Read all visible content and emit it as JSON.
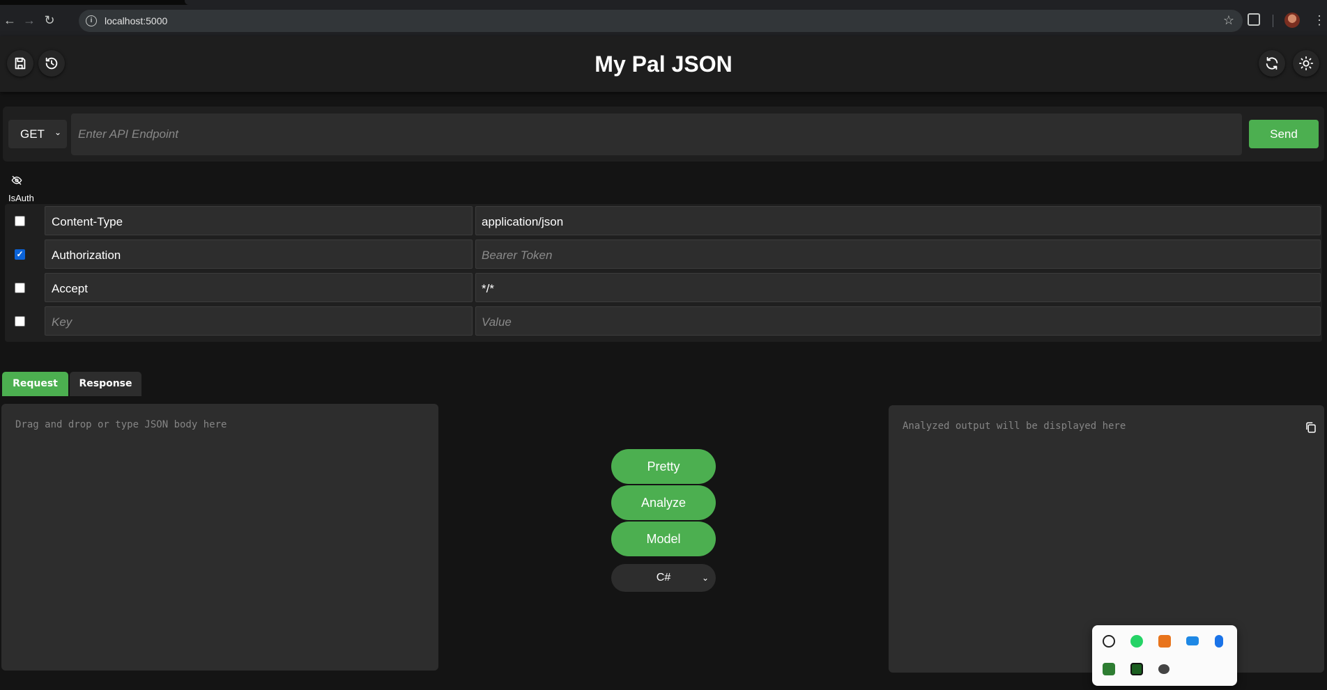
{
  "browser": {
    "url": "localhost:5000"
  },
  "header": {
    "title": "My Pal JSON",
    "left_icons": [
      "save-icon",
      "history-icon"
    ],
    "right_icons": [
      "refresh-icon",
      "theme-sun-icon"
    ]
  },
  "request_bar": {
    "method": "GET",
    "endpoint_placeholder": "Enter API Endpoint",
    "send_label": "Send"
  },
  "auth": {
    "label": "IsAuth",
    "icon": "eye-off-icon"
  },
  "headers_table": {
    "rows": [
      {
        "checked": false,
        "key": "Content-Type",
        "value": "application/json",
        "key_placeholder": "",
        "value_placeholder": ""
      },
      {
        "checked": true,
        "key": "Authorization",
        "value": "",
        "key_placeholder": "",
        "value_placeholder": "Bearer Token"
      },
      {
        "checked": false,
        "key": "Accept",
        "value": "*/*",
        "key_placeholder": "",
        "value_placeholder": ""
      },
      {
        "checked": false,
        "key": "",
        "value": "",
        "key_placeholder": "Key",
        "value_placeholder": "Value"
      }
    ]
  },
  "tabs": [
    {
      "label": "Request",
      "active": true
    },
    {
      "label": "Response",
      "active": false
    }
  ],
  "editor": {
    "placeholder": "Drag and drop or type JSON body here"
  },
  "actions": {
    "pretty": "Pretty",
    "analyze": "Analyze",
    "model": "Model",
    "language": "C#"
  },
  "output": {
    "placeholder": "Analyzed output will be displayed here"
  },
  "colors": {
    "accent": "#4caf50",
    "background": "#141414",
    "panel": "#2d2d2d"
  },
  "system_tray": {
    "icons": [
      "chatgpt-icon",
      "whatsapp-icon",
      "sublime-icon",
      "display-icon",
      "bluetooth-icon",
      "nvidia-icon",
      "nvidia-shield-icon",
      "security-icon"
    ]
  }
}
